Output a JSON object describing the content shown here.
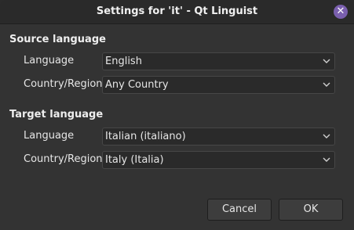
{
  "window": {
    "title": "Settings for 'it' - Qt Linguist",
    "close_icon": "close-icon",
    "accent_color": "#7a5fae"
  },
  "source": {
    "heading": "Source language",
    "language_label": "Language",
    "language_value": "English",
    "country_label": "Country/Region",
    "country_value": "Any Country"
  },
  "target": {
    "heading": "Target language",
    "language_label": "Language",
    "language_value": "Italian (italiano)",
    "country_label": "Country/Region",
    "country_value": "Italy (Italia)"
  },
  "buttons": {
    "cancel_label": "Cancel",
    "ok_label": "OK"
  }
}
